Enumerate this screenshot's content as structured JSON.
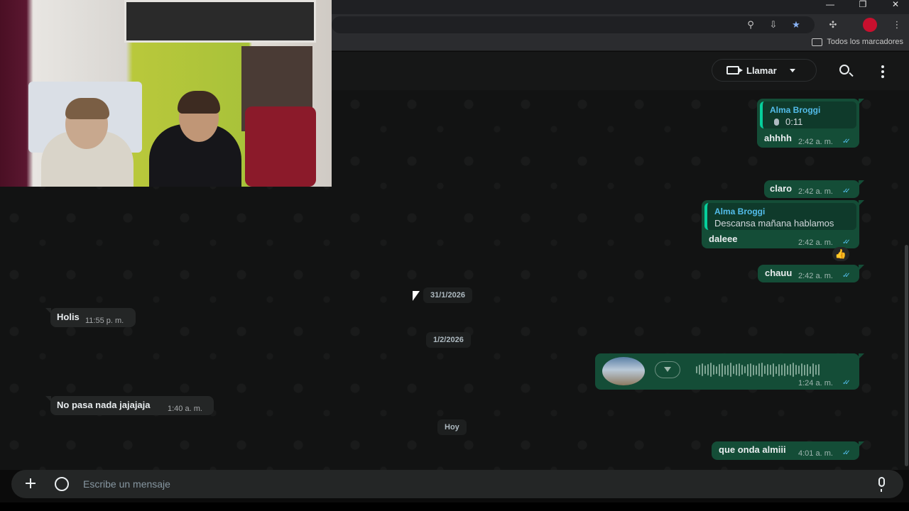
{
  "browser": {
    "bookmarks_all": "Todos los marcadores",
    "window_controls": [
      "minimize",
      "restore",
      "close"
    ],
    "toolbar_icons": [
      "zoom-icon",
      "install-app-icon",
      "bookmark-star-icon",
      "extensions-icon",
      "profile-avatar",
      "menu-icon"
    ]
  },
  "header": {
    "call_label": "Llamar"
  },
  "messages": {
    "m1": {
      "quote_author": "Alma Broggi",
      "quote_duration": "0:11",
      "text": "ahhhh",
      "time": "2:42 a. m."
    },
    "m2": {
      "text": "claro",
      "time": "2:42 a. m."
    },
    "m3": {
      "quote_author": "Alma Broggi",
      "quote_text": "Descansa mañana hablamos",
      "text": "daleee",
      "time": "2:42 a. m.",
      "reaction": "👍"
    },
    "m4": {
      "text": "chauu",
      "time": "2:42 a. m."
    },
    "m5": {
      "text": "Holis",
      "time": "11:55 p. m."
    },
    "m6": {
      "time": "1:24 a. m."
    },
    "m7": {
      "text": "No pasa nada jajajaja",
      "time": "1:40 a. m."
    },
    "m8": {
      "text": "que onda almiii",
      "time": "4:01 a. m."
    }
  },
  "dates": {
    "d1": "31/1/2026",
    "d2": "1/2/2026",
    "d3": "Hoy"
  },
  "composer": {
    "placeholder": "Escribe un mensaje"
  },
  "colors": {
    "outgoing_bubble": "#144d37",
    "incoming_bubble": "#242626",
    "read_ticks": "#53bdeb",
    "quote_author": "#53bdeb"
  }
}
